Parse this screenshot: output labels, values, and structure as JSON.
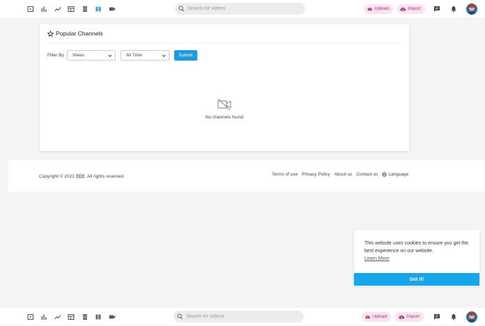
{
  "topbar": {
    "nav_icons": [
      "video-library-icon",
      "bar-chart-icon",
      "trending-icon",
      "calendar-icon",
      "playlist-icon",
      "live-icon",
      "camera-icon"
    ],
    "active_nav_index": 5,
    "search_placeholder": "Search for videos",
    "upload_label": "Upload",
    "import_label": "Import",
    "accent_color": "#1a9ae0",
    "pill_bg": "#fbe3f1",
    "pill_color": "#c2267a"
  },
  "card": {
    "title": "Popular Channels",
    "filter_label": "Filter By",
    "sort_value": "Views",
    "time_value": "All Time",
    "submit_label": "Submit",
    "empty_text": "No channels found"
  },
  "footer": {
    "copyright": "Copyright © 2023 測試. All rights reserved.",
    "links": [
      "Terms of use",
      "Privacy Policy",
      "About us",
      "Contact us"
    ],
    "language_label": "Language"
  },
  "cookie": {
    "message": "This website uses cookies to ensure you get the best experience on our website.",
    "learn_more": "Learn More",
    "button": "Got it!",
    "button_color": "#14a7ee"
  }
}
